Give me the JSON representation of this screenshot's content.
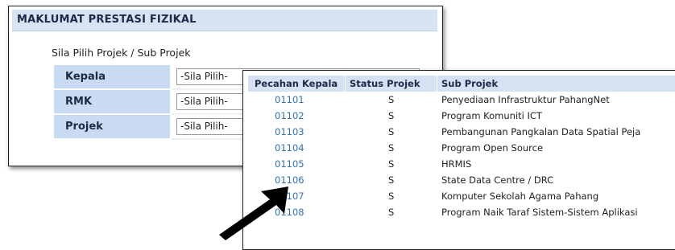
{
  "panel": {
    "title": "MAKLUMAT PRESTASI FIZIKAL",
    "section_label": "Sila Pilih Projek / Sub Projek",
    "fields": [
      {
        "label": "Kepala",
        "value": "-Sila Pilih-"
      },
      {
        "label": "RMK",
        "value": "-Sila Pilih-"
      },
      {
        "label": "Projek",
        "value": "-Sila Pilih-"
      }
    ]
  },
  "popup": {
    "columns": [
      "Pecahan Kepala",
      "Status Projek",
      "Sub Projek"
    ],
    "rows": [
      {
        "code": "01101",
        "status": "S",
        "name": "Penyediaan Infrastruktur PahangNet"
      },
      {
        "code": "01102",
        "status": "S",
        "name": "Program Komuniti ICT"
      },
      {
        "code": "01103",
        "status": "S",
        "name": "Pembangunan Pangkalan Data Spatial Peja"
      },
      {
        "code": "01104",
        "status": "S",
        "name": "Program Open Source"
      },
      {
        "code": "01105",
        "status": "S",
        "name": "HRMIS"
      },
      {
        "code": "01106",
        "status": "S",
        "name": "State Data Centre / DRC"
      },
      {
        "code": "01107",
        "status": "S",
        "name": "Komputer Sekolah Agama Pahang"
      },
      {
        "code": "01108",
        "status": "S",
        "name": "Program Naik Taraf Sistem-Sistem Aplikasi"
      }
    ]
  },
  "colors": {
    "header_bg": "#d6e4f3",
    "label_bg": "#c8dbf2",
    "link": "#2f6fb5",
    "title_text": "#1d2a48"
  }
}
